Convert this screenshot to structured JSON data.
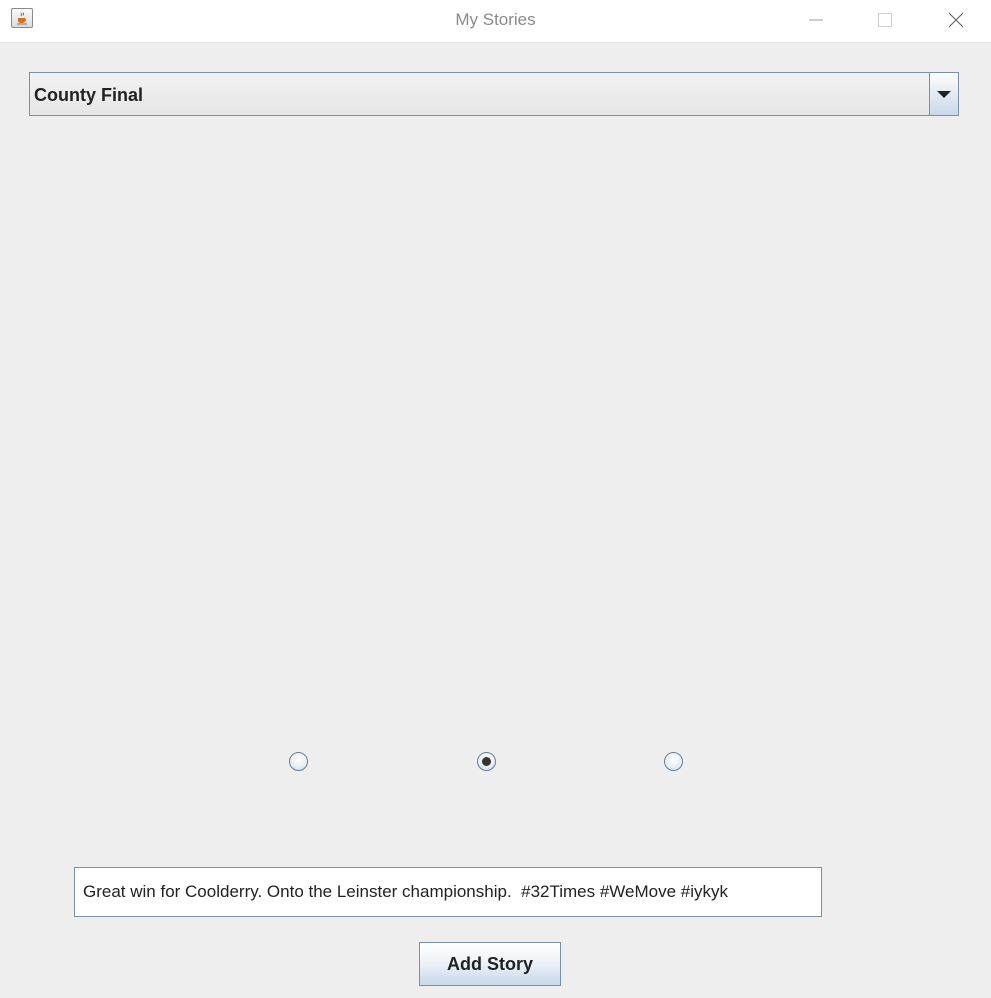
{
  "window": {
    "title": "My Stories",
    "app_icon": "java-cup-icon",
    "controls": {
      "minimize_icon": "minimize-icon",
      "maximize_icon": "maximize-icon",
      "close_icon": "close-icon"
    }
  },
  "story_selector": {
    "selected": "County Final",
    "arrow_icon": "chevron-down-icon"
  },
  "radio_group": {
    "options": [
      {
        "checked": false
      },
      {
        "checked": true
      },
      {
        "checked": false
      }
    ]
  },
  "story_input": {
    "value": "Great win for Coolderry. Onto the Leinster championship.  #32Times #WeMove #iykyk"
  },
  "add_button": {
    "label": "Add Story"
  },
  "colors": {
    "background": "#eeeeee",
    "accent_border": "#7a8fa8",
    "button_gradient_end": "#c9d8ea"
  }
}
